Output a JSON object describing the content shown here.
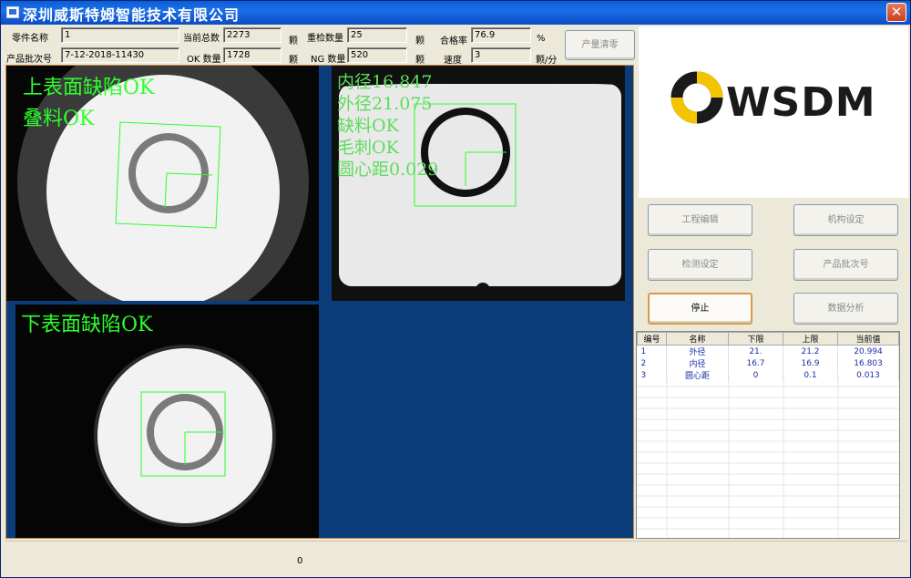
{
  "window": {
    "title": "深圳威斯特姆智能技术有限公司",
    "close_glyph": "✕"
  },
  "info": {
    "part_name_label": "零件名称",
    "part_name": "1",
    "batch_label": "产品批次号",
    "batch": "7-12-2018-11430",
    "total_label": "当前总数",
    "total": "2273",
    "total_unit": "颗",
    "ok_label": "OK 数量",
    "ok": "1728",
    "ok_unit": "颗",
    "recheck_label": "重检数量",
    "recheck": "25",
    "recheck_unit": "颗",
    "ng_label": "NG 数量",
    "ng": "520",
    "ng_unit": "颗",
    "pass_label": "合格率",
    "pass": "76.9",
    "pass_unit": "%",
    "speed_label": "速度",
    "speed": "3",
    "speed_unit": "颗/分",
    "clear_label": "产量清零"
  },
  "views": {
    "top": {
      "line1": "上表面缺陷OK",
      "line2": "叠料OK"
    },
    "side": {
      "lines": [
        "内径16.847",
        "外径21.075",
        "缺料OK",
        "毛刺OK",
        "圆心距0.029"
      ]
    },
    "bottom": {
      "line1": "下表面缺陷OK"
    }
  },
  "logo": {
    "text": "WSDM",
    "accent": "#f5c400"
  },
  "buttons": {
    "project_edit": "工程编辑",
    "mechanism": "机构设定",
    "detect": "检测设定",
    "batch_no": "产品批次号",
    "stop": "停止",
    "analysis": "数据分析"
  },
  "table": {
    "headers": [
      "编号",
      "名称",
      "下限",
      "上限",
      "当前值"
    ],
    "rows": [
      [
        "1",
        "外径",
        "21.",
        "21.2",
        "20.994"
      ],
      [
        "2",
        "内径",
        "16.7",
        "16.9",
        "16.803"
      ],
      [
        "3",
        "圆心距",
        "0",
        "0.1",
        "0.013"
      ]
    ]
  },
  "status": {
    "value": "0"
  }
}
